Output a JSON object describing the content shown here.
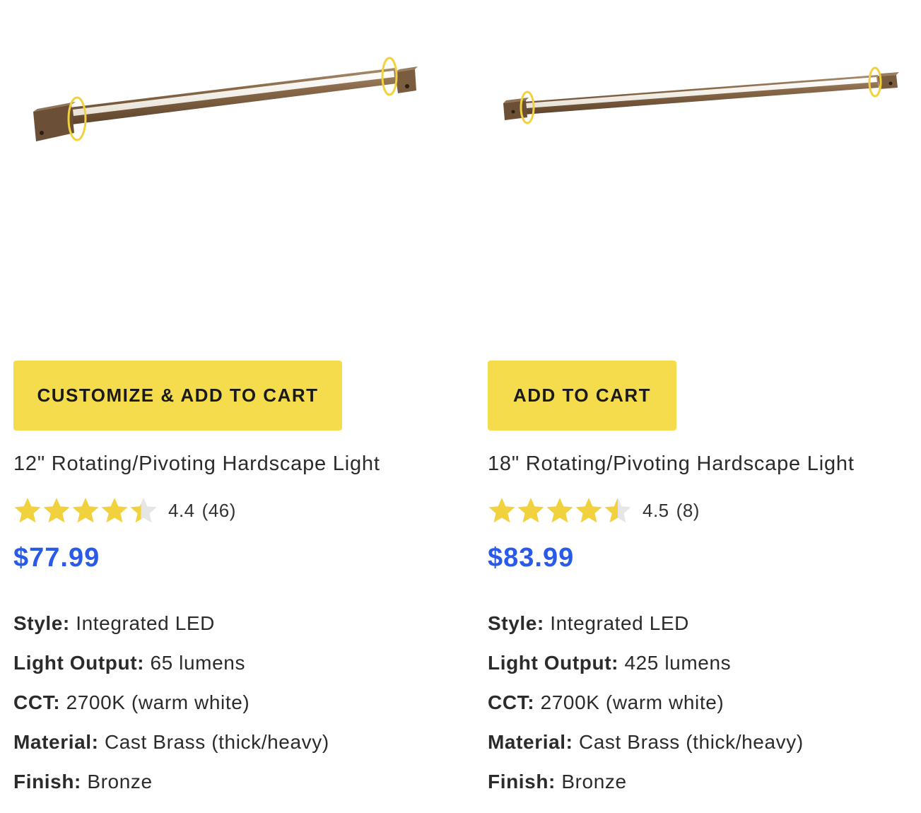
{
  "colors": {
    "button_bg": "#f5dc4d",
    "price": "#2a5be8",
    "star_filled": "#f2d13f",
    "star_empty": "#e6e6e6",
    "fixture_bronze": "#8a6a4a"
  },
  "products": [
    {
      "image_icon": "rotating-hardscape-light-12in",
      "button_label": "CUSTOMIZE & ADD TO CART",
      "title": "12\" Rotating/Pivoting Hardscape Light",
      "rating": {
        "value": 4.4,
        "value_text": "4.4",
        "count_text": "(46)",
        "stars_max": 5
      },
      "price": "$77.99",
      "specs": [
        {
          "label": "Style:",
          "value": "Integrated LED"
        },
        {
          "label": "Light Output:",
          "value": "65 lumens"
        },
        {
          "label": "CCT:",
          "value": "2700K (warm white)"
        },
        {
          "label": "Material:",
          "value": "Cast Brass (thick/heavy)"
        },
        {
          "label": "Finish:",
          "value": "Bronze"
        }
      ]
    },
    {
      "image_icon": "rotating-hardscape-light-18in",
      "button_label": "ADD TO CART",
      "title": "18\" Rotating/Pivoting Hardscape Light",
      "rating": {
        "value": 4.5,
        "value_text": "4.5",
        "count_text": "(8)",
        "stars_max": 5
      },
      "price": "$83.99",
      "specs": [
        {
          "label": "Style:",
          "value": "Integrated LED"
        },
        {
          "label": "Light Output:",
          "value": "425 lumens"
        },
        {
          "label": "CCT:",
          "value": "2700K (warm white)"
        },
        {
          "label": "Material:",
          "value": "Cast Brass (thick/heavy)"
        },
        {
          "label": "Finish:",
          "value": "Bronze"
        }
      ]
    }
  ]
}
